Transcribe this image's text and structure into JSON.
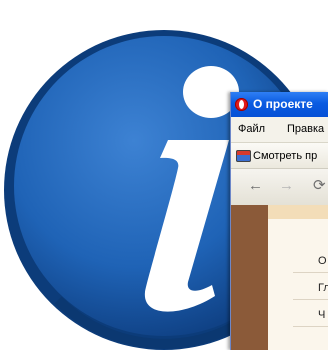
{
  "window": {
    "title": "О проекте"
  },
  "menu": {
    "items": [
      {
        "label": "Файл"
      },
      {
        "label": "Правка"
      }
    ]
  },
  "bookmarks": {
    "items": [
      {
        "label": "Смотреть пр"
      }
    ]
  },
  "navigation": {
    "back_glyph": "←",
    "forward_glyph": "→",
    "reload_glyph": "⟳"
  },
  "page": {
    "links": [
      {
        "label": "О"
      },
      {
        "label": "Гл"
      },
      {
        "label": "Ч"
      }
    ]
  },
  "colors": {
    "info_icon_blue": "#1f63b6",
    "titlebar_blue": "#0a5be1",
    "sidebar_brown": "#8b5a39"
  }
}
